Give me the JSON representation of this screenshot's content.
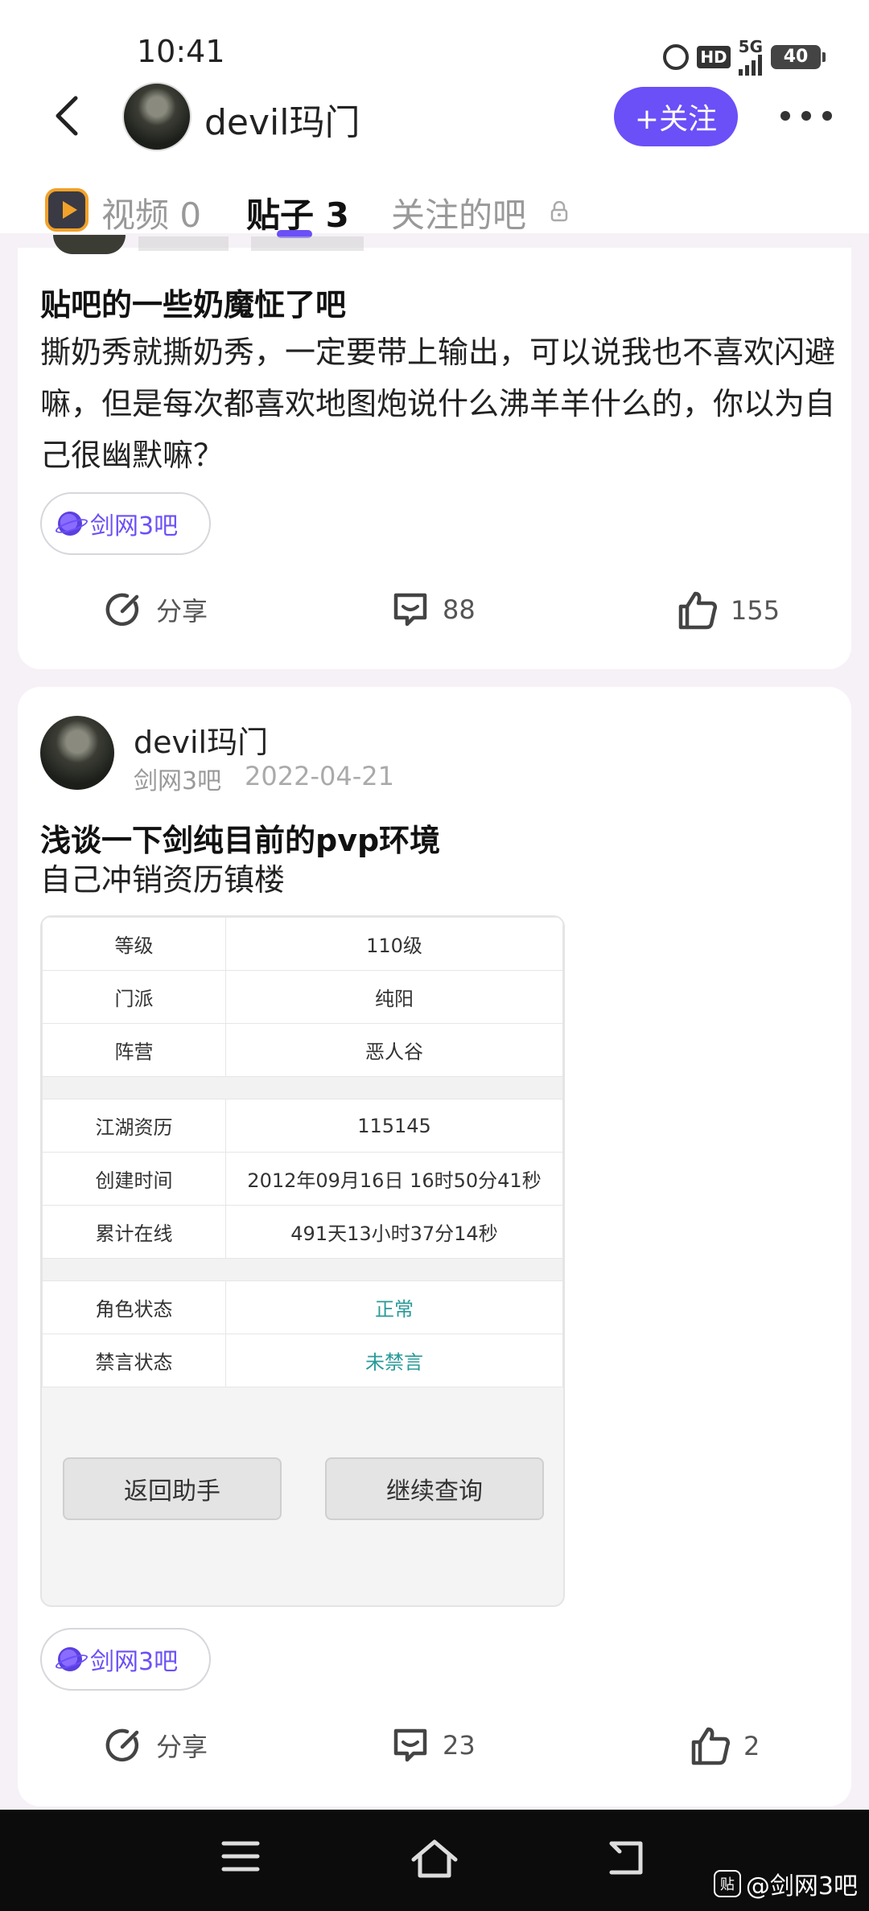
{
  "status_bar": {
    "time": "10:41",
    "network": "5G",
    "hd": "HD",
    "battery": "40"
  },
  "header": {
    "username": "devil玛门",
    "follow_label": "+关注"
  },
  "tabs": [
    {
      "label": "视频 0"
    },
    {
      "label": "贴子 3"
    },
    {
      "label": "关注的吧"
    }
  ],
  "posts": [
    {
      "title": "贴吧的一些奶魔怔了吧",
      "body": "撕奶秀就撕奶秀，一定要带上输出，可以说我也不喜欢闪避嘛，但是每次都喜欢地图炮说什么沸羊羊什么的，你以为自己很幽默嘛？",
      "forum": "剑网3吧",
      "share_label": "分享",
      "comments": "88",
      "likes": "155"
    },
    {
      "author": "devil玛门",
      "forum_meta": "剑网3吧",
      "date": "2022-04-21",
      "title": "浅谈一下剑纯目前的pvp环境",
      "body": "自己冲销资历镇楼",
      "forum": "剑网3吧",
      "share_label": "分享",
      "comments": "23",
      "likes": "2",
      "screenshot": {
        "rows1": [
          {
            "k": "等级",
            "v": "110级"
          },
          {
            "k": "门派",
            "v": "纯阳"
          },
          {
            "k": "阵营",
            "v": "恶人谷"
          }
        ],
        "rows2": [
          {
            "k": "江湖资历",
            "v": "115145"
          },
          {
            "k": "创建时间",
            "v": "2012年09月16日 16时50分41秒"
          },
          {
            "k": "累计在线",
            "v": "491天13小时37分14秒"
          }
        ],
        "rows3": [
          {
            "k": "角色状态",
            "v": "正常"
          },
          {
            "k": "禁言状态",
            "v": "未禁言"
          }
        ],
        "btn_back": "返回助手",
        "btn_continue": "继续查询"
      }
    }
  ],
  "watermark": {
    "logo": "贴",
    "text": "@剑网3吧"
  },
  "colors": {
    "accent": "#6b4ff7",
    "teal": "#2a9a9a"
  }
}
